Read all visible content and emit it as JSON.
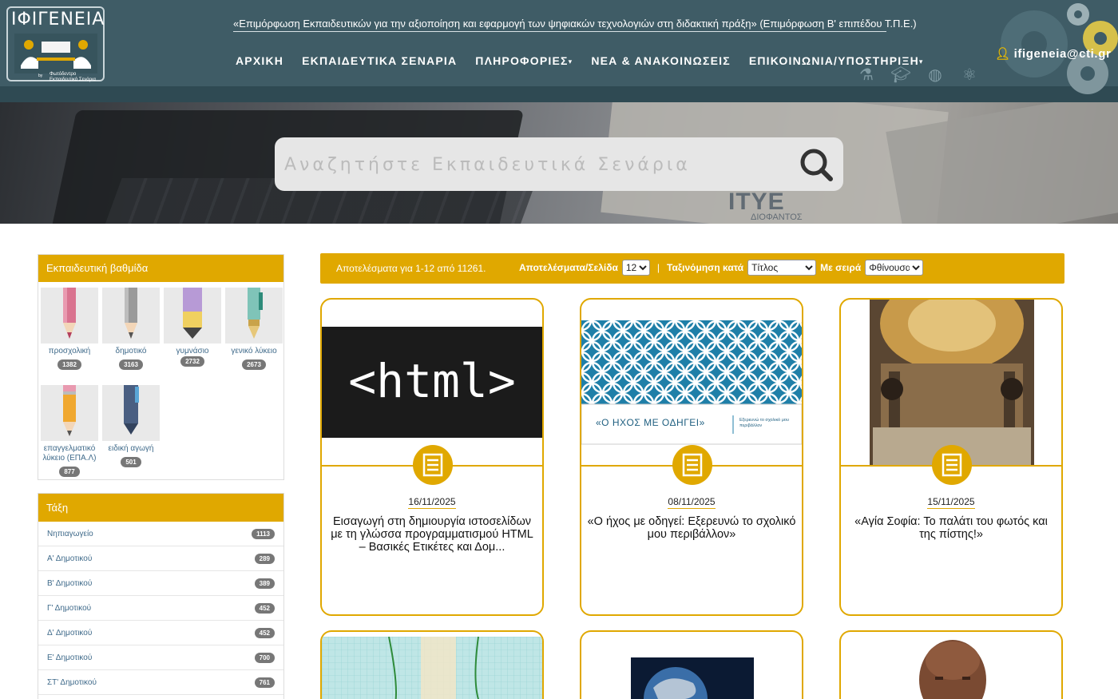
{
  "header": {
    "logo_title": "ΙΦΙΓΕΝΕΙΑ",
    "logo_by": "by",
    "logo_subtitle": "Φωτόδεντρο Εκπαιδευτικά Σενάρια",
    "tagline": "«Επιμόρφωση Εκπαιδευτικών για την αξιοποίηση και εφαρμογή των ψηφιακών τεχνολογιών στη διδακτική πράξη» (Επιμόρφωση Β' επιπέδου Τ.Π.Ε.)",
    "nav": [
      {
        "label": "ΑΡΧΙΚΗ",
        "dropdown": false
      },
      {
        "label": "ΕΚΠΑΙΔΕΥΤΙΚΑ ΣΕΝΑΡΙΑ",
        "dropdown": false
      },
      {
        "label": "ΠΛΗΡΟΦΟΡΙΕΣ",
        "dropdown": true
      },
      {
        "label": "ΝΕΑ & ΑΝΑΚΟΙΝΩΣΕΙΣ",
        "dropdown": false
      },
      {
        "label": "ΕΠΙΚΟΙΝΩΝΙΑ/ΥΠΟΣΤΗΡΙΞΗ",
        "dropdown": true
      }
    ],
    "user": "ifigeneia@cti.gr",
    "icons": [
      "flask-icon",
      "graduation-cap-icon",
      "globe-icon",
      "atom-icon"
    ]
  },
  "hero": {
    "search_placeholder": "Αναζητήστε Εκπαιδευτικά Σενάρια",
    "watermark": "ΙΤΥΕ",
    "watermark_sub": "ΔΙΟΦΑΝΤΟΣ"
  },
  "sidebar": {
    "grades_title": "Εκπαιδευτική βαθμίδα",
    "grades": [
      {
        "label": "προσχολική",
        "count": "1382",
        "color": "#d9738f"
      },
      {
        "label": "δημοτικό",
        "count": "3163",
        "color": "#9a9a9a"
      },
      {
        "label": "γυμνάσιο",
        "count": "2732",
        "color": "#b79ad6"
      },
      {
        "label": "γενικό λύκειο",
        "count": "2673",
        "color": "#7fc4b8"
      },
      {
        "label": "επαγγελματικό λύκειο (ΕΠΑ.Λ)",
        "count": "877",
        "color": "#f0a830"
      },
      {
        "label": "ειδική αγωγή",
        "count": "501",
        "color": "#4a5f82"
      }
    ],
    "classes_title": "Τάξη",
    "classes": [
      {
        "label": "Νηπιαγωγείο",
        "count": "1113"
      },
      {
        "label": "Α' Δημοτικού",
        "count": "289"
      },
      {
        "label": "Β' Δημοτικού",
        "count": "389"
      },
      {
        "label": "Γ' Δημοτικού",
        "count": "452"
      },
      {
        "label": "Δ' Δημοτικού",
        "count": "452"
      },
      {
        "label": "Ε' Δημοτικού",
        "count": "700"
      },
      {
        "label": "ΣΤ' Δημοτικού",
        "count": "761"
      }
    ]
  },
  "results": {
    "count_text": "Αποτελέσματα για 1-12 από 11261.",
    "per_page_label": "Αποτελέσματα/Σελίδα",
    "per_page_value": "12",
    "separator": "|",
    "sort_label": "Ταξινόμηση κατά",
    "sort_value": "Τίτλος",
    "order_label": "Με σειρά",
    "order_value": "Φθίνουσα"
  },
  "cards": [
    {
      "date": "16/11/2025",
      "title": "Εισαγωγή στη δημιουργία ιστοσελίδων με τη γλώσσα προγραμματισμού HTML – Βασικές Ετικέτες και Δομ...",
      "image_text": "<html>"
    },
    {
      "date": "08/11/2025",
      "title": "«Ο ήχος με οδηγεί: Εξερευνώ το σχολικό μου περιβάλλον»",
      "image_text": "«Ο ΗΧΟΣ ΜΕ ΟΔΗΓΕΙ»",
      "image_sub": "Εξερευνώ το σχολικό μου περιβάλλον"
    },
    {
      "date": "15/11/2025",
      "title": "«Αγία Σοφία: Το παλάτι του φωτός και της πίστης!»"
    }
  ],
  "colors": {
    "accent": "#e0a800",
    "header": "#3f5c66",
    "link": "#3f6a8a"
  }
}
